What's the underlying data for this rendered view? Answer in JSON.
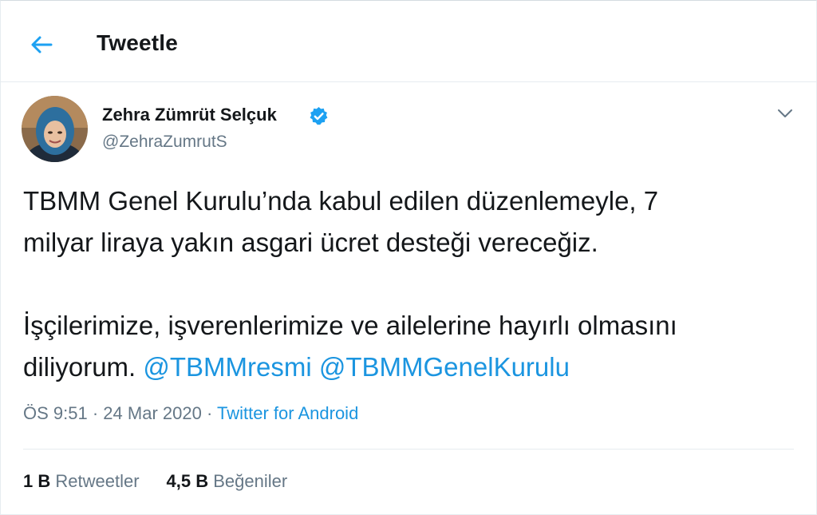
{
  "header": {
    "title": "Tweetle",
    "back_icon": "arrow-left-icon"
  },
  "tweet": {
    "author": {
      "display_name": "Zehra Zümrüt Selçuk",
      "handle": "@ZehraZumrutS",
      "verified": true
    },
    "text": {
      "line1": "TBMM Genel Kurulu’nda kabul edilen düzenlemeyle, 7",
      "line2": "milyar liraya yakın asgari ücret desteği vereceğiz.",
      "line3": "İşçilerimize, işverenlerimize ve ailelerine hayırlı olmasını",
      "line4_prefix": "diliyorum.",
      "mention1": "@TBMMresmi",
      "mention2": "@TBMMGenelKurulu"
    },
    "meta": {
      "time": "ÖS 9:51",
      "sep1": "·",
      "date": "24 Mar 2020",
      "sep2": "·",
      "source": "Twitter for Android"
    },
    "stats": {
      "retweets_count": "1 B",
      "retweets_label": "Retweetler",
      "likes_count": "4,5 B",
      "likes_label": "Beğeniler"
    }
  },
  "colors": {
    "accent": "#1b95e0",
    "muted": "#657786",
    "text": "#14171a",
    "border": "#e6ecf0"
  }
}
